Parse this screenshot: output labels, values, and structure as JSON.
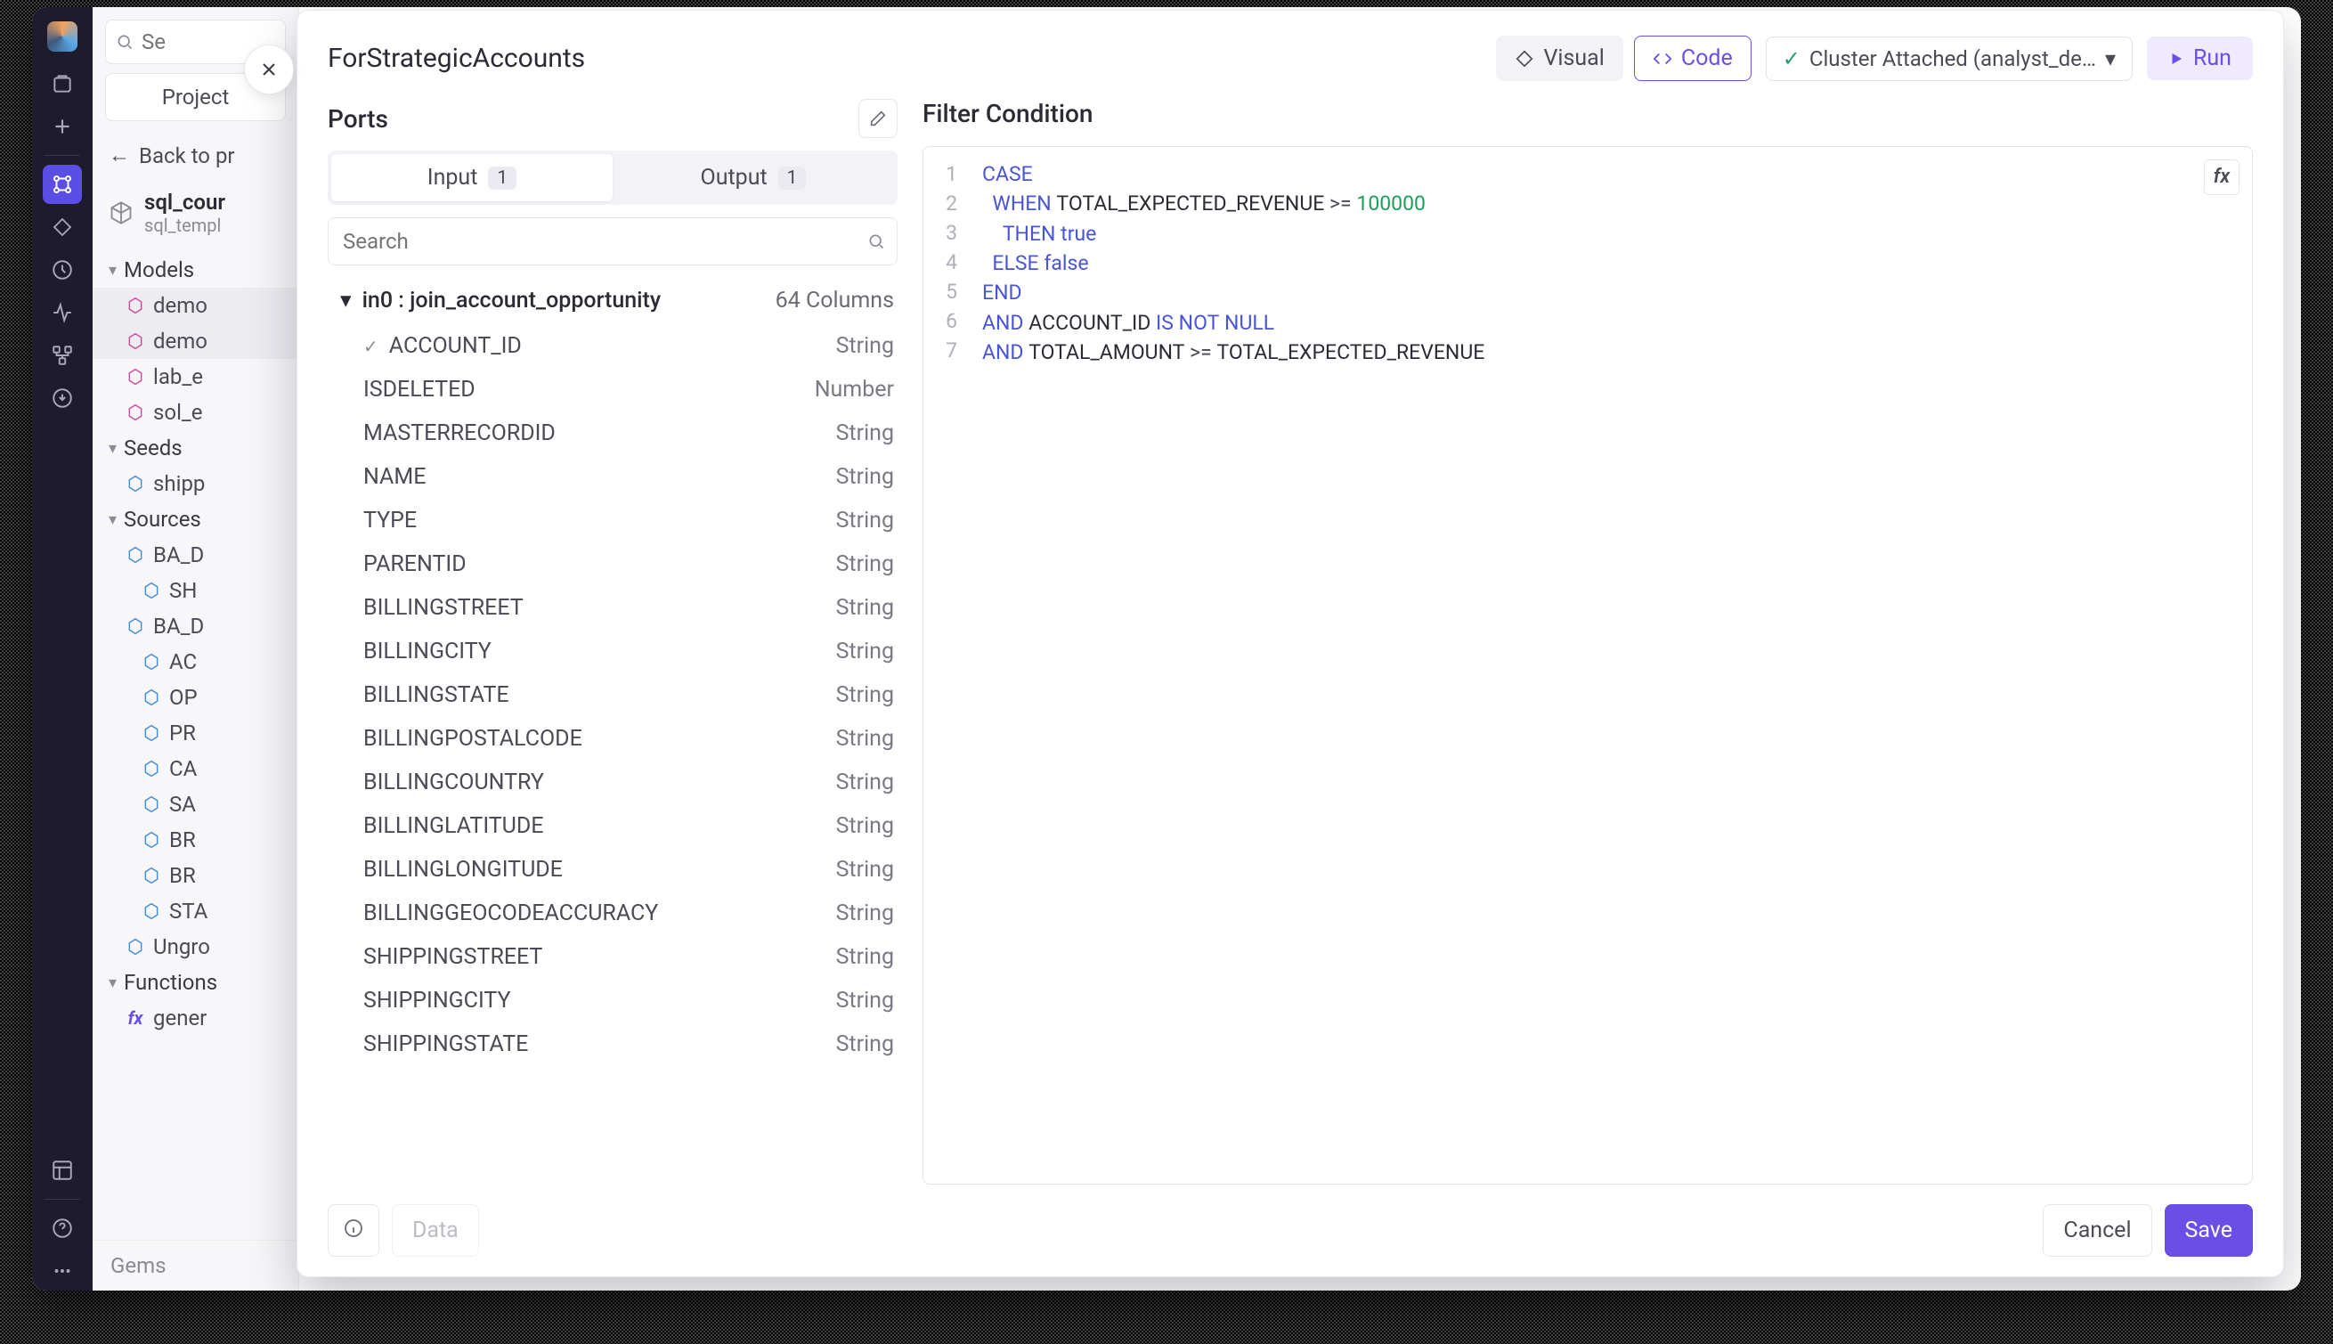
{
  "sidebar": {
    "search_placeholder": "Se",
    "project_btn": "Project",
    "back": "Back to pr",
    "title_main": "sql_cour",
    "title_sub": "sql_templ",
    "models_label": "Models",
    "models": [
      "demo",
      "demo",
      "lab_e",
      "sol_e"
    ],
    "seeds_label": "Seeds",
    "seeds": [
      "shipp"
    ],
    "sources_label": "Sources",
    "sources": [
      {
        "label": "BA_D",
        "sub": false
      },
      {
        "label": "SH",
        "sub": true
      },
      {
        "label": "BA_D",
        "sub": false
      },
      {
        "label": "AC",
        "sub": true
      },
      {
        "label": "OP",
        "sub": true
      },
      {
        "label": "PR",
        "sub": true
      },
      {
        "label": "CA",
        "sub": true
      },
      {
        "label": "SA",
        "sub": true
      },
      {
        "label": "BR",
        "sub": true
      },
      {
        "label": "BR",
        "sub": true
      },
      {
        "label": "STA",
        "sub": true
      }
    ],
    "ungrouped": "Ungro",
    "functions_label": "Functions",
    "functions": [
      "gener"
    ],
    "gems": "Gems"
  },
  "modal": {
    "title": "ForStrategicAccounts",
    "visual": "Visual",
    "code": "Code",
    "cluster": "Cluster Attached (analyst_de…",
    "run": "Run",
    "ports_heading": "Ports",
    "input_tab": "Input",
    "input_count": "1",
    "output_tab": "Output",
    "output_count": "1",
    "port_search_placeholder": "Search",
    "port_group": "in0 : join_account_opportunity",
    "col_count": "64 Columns",
    "columns": [
      {
        "name": "ACCOUNT_ID",
        "type": "String",
        "checked": true
      },
      {
        "name": "ISDELETED",
        "type": "Number"
      },
      {
        "name": "MASTERRECORDID",
        "type": "String"
      },
      {
        "name": "NAME",
        "type": "String"
      },
      {
        "name": "TYPE",
        "type": "String"
      },
      {
        "name": "PARENTID",
        "type": "String"
      },
      {
        "name": "BILLINGSTREET",
        "type": "String"
      },
      {
        "name": "BILLINGCITY",
        "type": "String"
      },
      {
        "name": "BILLINGSTATE",
        "type": "String"
      },
      {
        "name": "BILLINGPOSTALCODE",
        "type": "String"
      },
      {
        "name": "BILLINGCOUNTRY",
        "type": "String"
      },
      {
        "name": "BILLINGLATITUDE",
        "type": "String"
      },
      {
        "name": "BILLINGLONGITUDE",
        "type": "String"
      },
      {
        "name": "BILLINGGEOCODEACCURACY",
        "type": "String"
      },
      {
        "name": "SHIPPINGSTREET",
        "type": "String"
      },
      {
        "name": "SHIPPINGCITY",
        "type": "String"
      },
      {
        "name": "SHIPPINGSTATE",
        "type": "String"
      }
    ],
    "filter_heading": "Filter Condition",
    "code_lines": [
      [
        {
          "t": "CASE",
          "c": "kw"
        }
      ],
      [
        {
          "t": "  ",
          "c": ""
        },
        {
          "t": "WHEN",
          "c": "kw"
        },
        {
          "t": " TOTAL_EXPECTED_REVENUE ",
          "c": ""
        },
        {
          "t": ">=",
          "c": "op"
        },
        {
          "t": " ",
          "c": ""
        },
        {
          "t": "100000",
          "c": "num"
        }
      ],
      [
        {
          "t": "    ",
          "c": ""
        },
        {
          "t": "THEN",
          "c": "kw"
        },
        {
          "t": " ",
          "c": ""
        },
        {
          "t": "true",
          "c": "bool"
        }
      ],
      [
        {
          "t": "  ",
          "c": ""
        },
        {
          "t": "ELSE",
          "c": "kw"
        },
        {
          "t": " ",
          "c": ""
        },
        {
          "t": "false",
          "c": "bool"
        }
      ],
      [
        {
          "t": "END",
          "c": "kw"
        }
      ],
      [
        {
          "t": "AND",
          "c": "kw"
        },
        {
          "t": " ACCOUNT_ID ",
          "c": ""
        },
        {
          "t": "IS",
          "c": "kw2"
        },
        {
          "t": " ",
          "c": ""
        },
        {
          "t": "NOT",
          "c": "kw2"
        },
        {
          "t": " ",
          "c": ""
        },
        {
          "t": "NULL",
          "c": "kw2"
        }
      ],
      [
        {
          "t": "AND",
          "c": "kw"
        },
        {
          "t": " TOTAL_AMOUNT ",
          "c": ""
        },
        {
          "t": ">=",
          "c": "op"
        },
        {
          "t": " TOTAL_EXPECTED_REVENUE",
          "c": ""
        }
      ]
    ],
    "data_btn": "Data",
    "cancel": "Cancel",
    "save": "Save"
  }
}
